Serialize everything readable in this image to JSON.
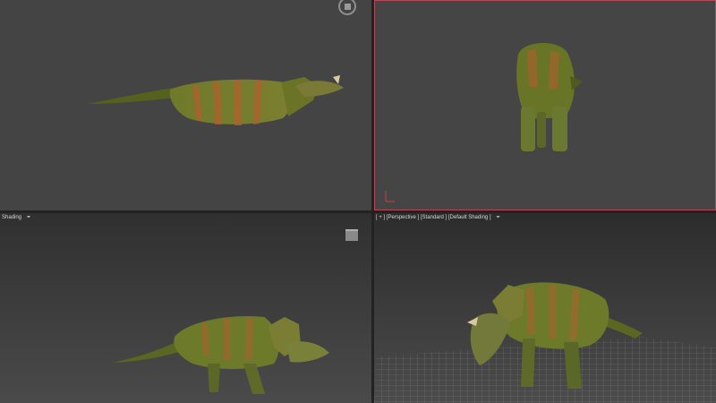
{
  "viewports": {
    "top": {
      "label": ""
    },
    "front": {
      "label": ""
    },
    "left": {
      "label": "Shading",
      "filter_icon": "filter-icon"
    },
    "perspective": {
      "label": "[ + ] [Perspective ] [Standard ] [Default Shading ]",
      "filter_icon": "filter-icon"
    }
  },
  "icons": {
    "view_cube": "view-cube-icon",
    "axis_tripod": "axis-tripod-icon",
    "filter": "filter-icon"
  },
  "colors": {
    "active_viewport_border": "#b5495a",
    "model_base": "#5d6a1f",
    "model_stripe": "#b0602e",
    "grid": "#8a8a8a"
  }
}
